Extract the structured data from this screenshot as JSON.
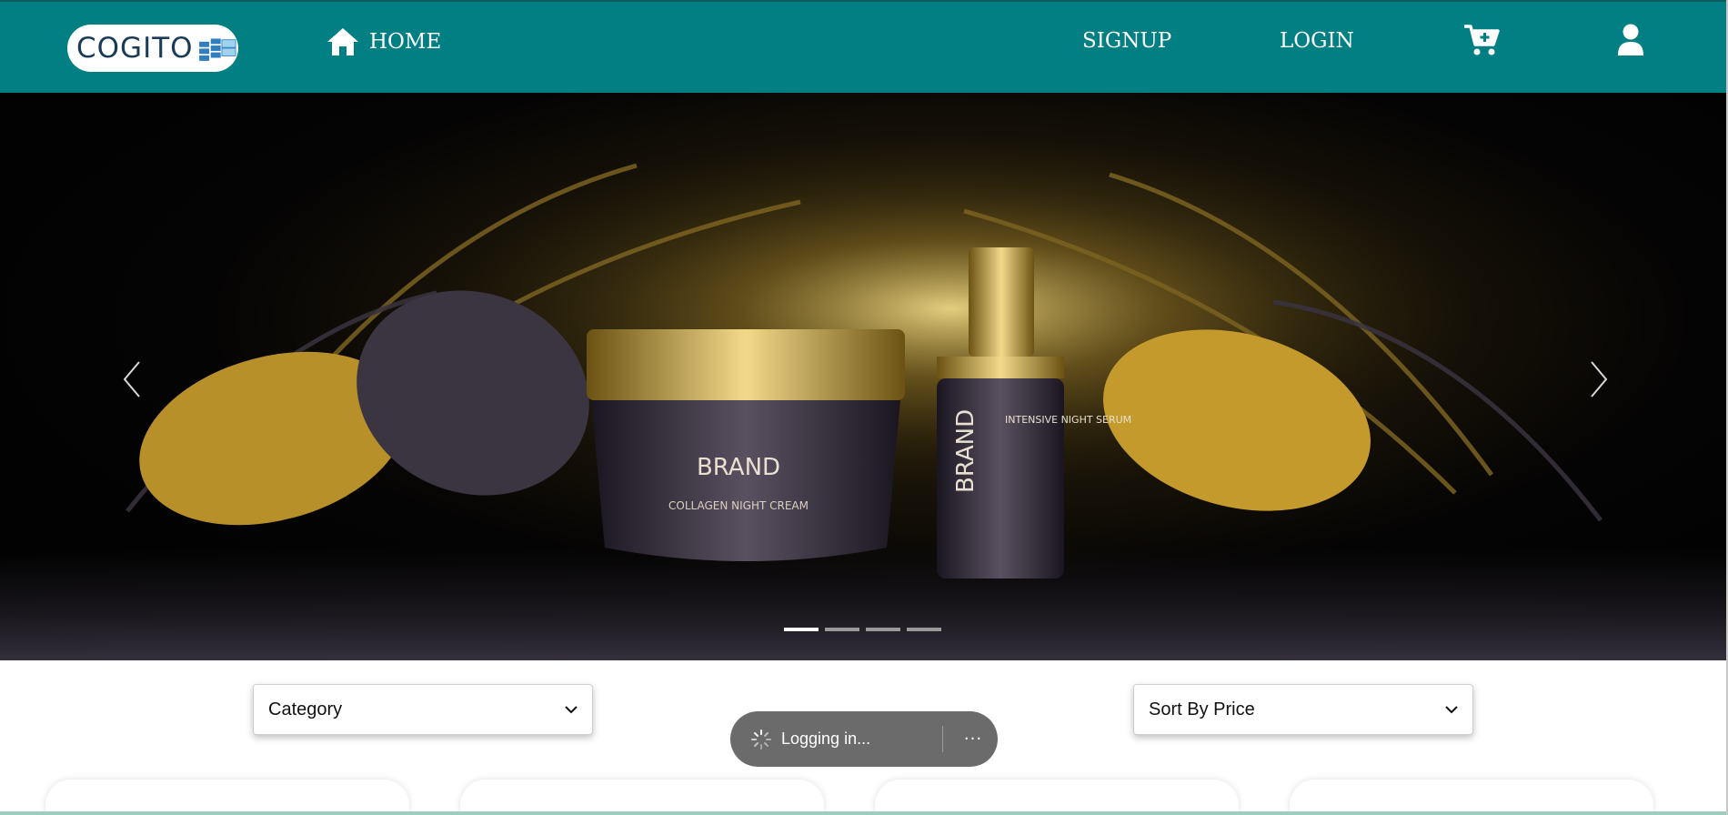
{
  "header": {
    "logo_text": "COGITO",
    "home_label": "HOME",
    "signup_label": "SIGNUP",
    "login_label": "LOGIN",
    "icons": [
      "home-icon",
      "cart-plus-icon",
      "user-icon"
    ],
    "background_color": "#017f82"
  },
  "carousel": {
    "slide_text": {
      "jar_brand": "BRAND",
      "jar_product": "COLLAGEN NIGHT CREAM",
      "bottle_brand": "BRAND",
      "bottle_product": "INTENSIVE NIGHT SERUM"
    },
    "slide_count": 4,
    "active_slide": 1,
    "icons": [
      "chevron-left-icon",
      "chevron-right-icon"
    ]
  },
  "filters": {
    "category": {
      "value": "Category"
    },
    "sort": {
      "value": "Sort By Price"
    }
  },
  "toast": {
    "message": "Logging in...",
    "more_label": "···"
  },
  "products": {
    "visible_cards": 4
  }
}
